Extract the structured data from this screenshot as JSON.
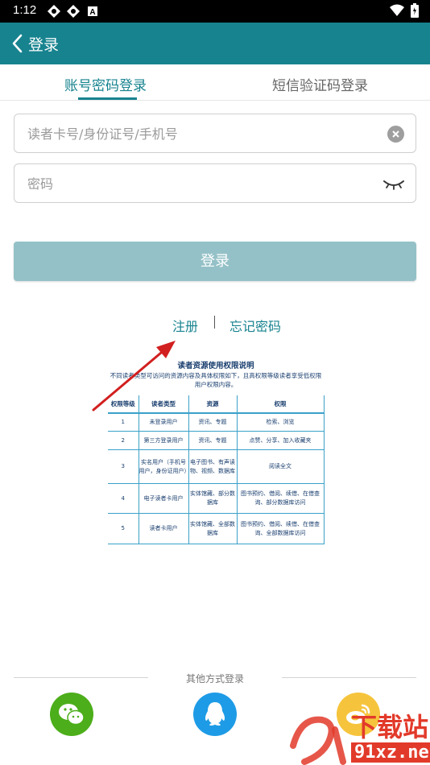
{
  "status_bar": {
    "time": "1:12"
  },
  "header": {
    "title": "登录"
  },
  "tabs": [
    {
      "label": "账号密码登录",
      "active": true
    },
    {
      "label": "短信验证码登录",
      "active": false
    }
  ],
  "form": {
    "account_placeholder": "读者卡号/身份证号/手机号",
    "password_placeholder": "密码",
    "login_label": "登录"
  },
  "links": {
    "register": "注册",
    "forgot": "忘记密码"
  },
  "rights_doc": {
    "title": "读者资源使用权限说明",
    "subtitle": "不同读者类型可访问的资源内容及具体权限如下，且高权限等级读者享受低权限用户权限内容。",
    "columns": [
      "权限等级",
      "读者类型",
      "资源",
      "权限"
    ],
    "rows": [
      [
        "1",
        "未登录用户",
        "资讯、专题",
        "检索、浏览"
      ],
      [
        "2",
        "第三方登录用户",
        "资讯、专题",
        "点赞、分享、加入收藏夹"
      ],
      [
        "3",
        "实名用户（手机号用户，身份证用户）",
        "电子图书、有声读物、视频、数据库",
        "阅读全文"
      ],
      [
        "4",
        "电子读者卡用户",
        "实体馆藏、部分数据库",
        "图书预约、借阅、续借、在借查询、部分数据库访问"
      ],
      [
        "5",
        "读者卡用户",
        "实体馆藏、全部数据库",
        "图书预约、借阅、续借、在借查询、全部数据库访问"
      ]
    ]
  },
  "other_login": {
    "label": "其他方式登录"
  },
  "watermark": {
    "big": "下载站",
    "small": "91xz.net"
  },
  "colors": {
    "primary": "#17838f",
    "button_disabled": "#94c1c7",
    "wechat": "#4cae1a",
    "qq": "#1e9be6",
    "weibo": "#f6c43c"
  }
}
